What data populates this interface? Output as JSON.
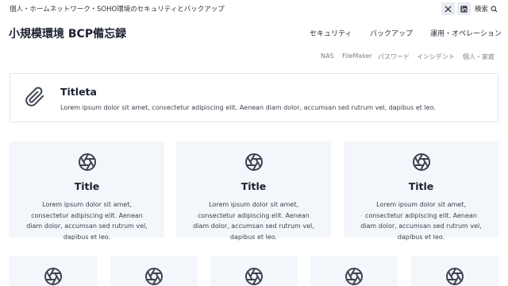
{
  "topbar": {
    "tagline": "個人・ホームネットワーク・SOHO環境のセキュリティとバックアップ",
    "search_label": "検索"
  },
  "icons": {
    "x": "x-logo-icon",
    "linkedin": "linkedin-icon",
    "search": "search-icon",
    "clip": "paperclip-icon",
    "aperture": "aperture-icon"
  },
  "site": {
    "title": "小規模環境 BCP備忘録"
  },
  "main_nav": [
    "セキュリティ",
    "バックアップ",
    "運用・オペレーション"
  ],
  "sub_nav": [
    "NAS",
    "FileMaker",
    "パスワード",
    "インシデント",
    "個人・家庭"
  ],
  "feature": {
    "title": "Titleta",
    "text": "Lorem ipsum dolor sit amet, consectetur adipiscing elit. Aenean diam dolor, accumsan sed rutrum vel, dapibus et leo."
  },
  "cards": [
    {
      "title": "Title",
      "text": "Lorem ipsum dolor sit amet, consectetur adipiscing elit. Aenean diam dolor, accumsan sed rutrum vel, dapibus et leo."
    },
    {
      "title": "Title",
      "text": "Lorem ipsum dolor sit amet, consectetur adipiscing elit. Aenean diam dolor, accumsan sed rutrum vel, dapibus et leo."
    },
    {
      "title": "Title",
      "text": "Lorem ipsum dolor sit amet, consectetur adipiscing elit. Aenean diam dolor, accumsan sed rutrum vel, dapibus et leo."
    }
  ],
  "colors": {
    "icon": "#3d4250",
    "card_bg": "#f3f6fa",
    "accent_text": "#1c2130"
  }
}
